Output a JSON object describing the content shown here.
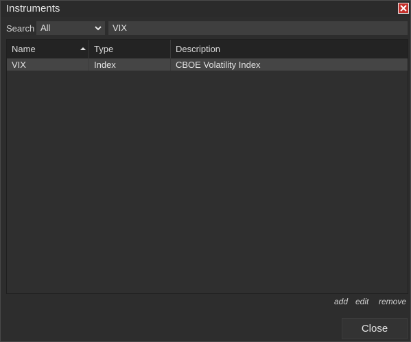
{
  "window": {
    "title": "Instruments"
  },
  "search": {
    "label": "Search",
    "filter_value": "All",
    "query": "VIX"
  },
  "table": {
    "columns": [
      {
        "label": "Name",
        "sorted": "ascending"
      },
      {
        "label": "Type"
      },
      {
        "label": "Description"
      }
    ],
    "rows": [
      {
        "name": "VIX",
        "type": "Index",
        "description": "CBOE Volatility Index"
      }
    ]
  },
  "actions": {
    "add": "add",
    "edit": "edit",
    "remove": "remove"
  },
  "footer": {
    "close_label": "Close"
  },
  "colors": {
    "background": "#2d2d2d",
    "header": "#232323",
    "selected_row": "#454545",
    "close_icon": "#c4302b"
  },
  "icons": {
    "close": "close-icon",
    "dropdown": "chevron-down-icon",
    "sort": "sort-ascending-icon"
  }
}
